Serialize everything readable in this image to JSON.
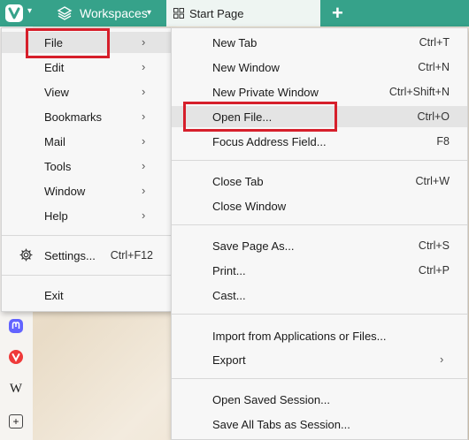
{
  "tabbar": {
    "workspaces_label": "Workspaces",
    "active_tab_title": "Start Page",
    "new_tab_glyph": "+",
    "dropdown_glyph": "▾"
  },
  "main_menu": {
    "items": [
      {
        "label": "File",
        "chev": "›"
      },
      {
        "label": "Edit",
        "chev": "›"
      },
      {
        "label": "View",
        "chev": "›"
      },
      {
        "label": "Bookmarks",
        "chev": "›"
      },
      {
        "label": "Mail",
        "chev": "›"
      },
      {
        "label": "Tools",
        "chev": "›"
      },
      {
        "label": "Window",
        "chev": "›"
      },
      {
        "label": "Help",
        "chev": "›"
      }
    ],
    "settings": {
      "label": "Settings...",
      "shortcut": "Ctrl+F12"
    },
    "exit": {
      "label": "Exit"
    }
  },
  "file_menu": {
    "new_tab": {
      "label": "New Tab",
      "shortcut": "Ctrl+T"
    },
    "new_window": {
      "label": "New Window",
      "shortcut": "Ctrl+N"
    },
    "new_private_window": {
      "label": "New Private Window",
      "shortcut": "Ctrl+Shift+N"
    },
    "open_file": {
      "label": "Open File...",
      "shortcut": "Ctrl+O"
    },
    "focus_address": {
      "label": "Focus Address Field...",
      "shortcut": "F8"
    },
    "close_tab": {
      "label": "Close Tab",
      "shortcut": "Ctrl+W"
    },
    "close_window": {
      "label": "Close Window"
    },
    "save_page": {
      "label": "Save Page As...",
      "shortcut": "Ctrl+S"
    },
    "print": {
      "label": "Print...",
      "shortcut": "Ctrl+P"
    },
    "cast": {
      "label": "Cast..."
    },
    "import": {
      "label": "Import from Applications or Files..."
    },
    "export": {
      "label": "Export",
      "chev": "›"
    },
    "open_saved_session": {
      "label": "Open Saved Session..."
    },
    "save_all_tabs": {
      "label": "Save All Tabs as Session..."
    }
  },
  "side_panel": {
    "wikipedia_glyph": "W",
    "add_glyph": "+"
  },
  "colors": {
    "accent": "#36a28a",
    "highlight_box": "#d61f2b",
    "vivaldi_red": "#ef3939",
    "mastodon_purple": "#6364ff"
  }
}
